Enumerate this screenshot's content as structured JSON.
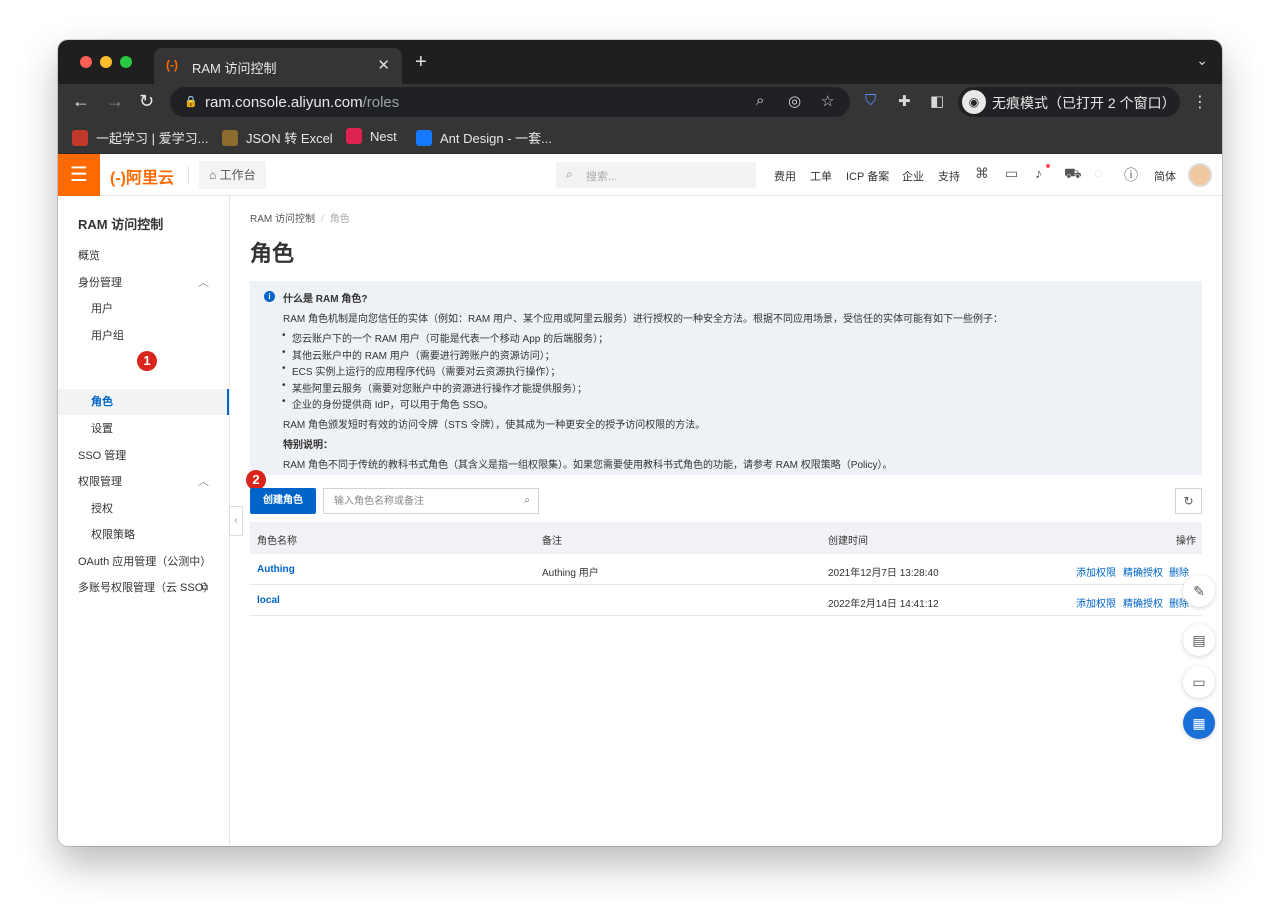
{
  "browser": {
    "tab_title": "RAM 访问控制",
    "favicon": "(-)",
    "url_host": "ram.console.aliyun.com",
    "url_path": "/roles",
    "incognito_label": "无痕模式（已打开 2 个窗口）",
    "bookmarks": [
      {
        "label": "一起学习 | 爱学习...",
        "color": "#c0392b"
      },
      {
        "label": "JSON 转 Excel",
        "color": "#8e6c2f"
      },
      {
        "label": "Nest",
        "color": "#e0234e"
      },
      {
        "label": "Ant Design - 一套...",
        "color": "#1677ff"
      }
    ]
  },
  "header": {
    "brand": "(-)阿里云",
    "workbench": "工作台",
    "search_placeholder": "搜索...",
    "links": [
      "费用",
      "工单",
      "ICP 备案",
      "企业",
      "支持"
    ],
    "lang": "简体",
    "accent": "#ff6a00"
  },
  "sidebar": {
    "title": "RAM 访问控制",
    "items": [
      {
        "label": "概览"
      },
      {
        "label": "身份管理"
      },
      {
        "label": "用户"
      },
      {
        "label": "用户组"
      },
      {
        "label": "角色"
      },
      {
        "label": "设置"
      },
      {
        "label": "SSO 管理"
      },
      {
        "label": "权限管理"
      },
      {
        "label": "授权"
      },
      {
        "label": "权限策略"
      },
      {
        "label": "OAuth 应用管理（公测中）"
      },
      {
        "label": "多账号权限管理（云 SSO）"
      }
    ],
    "badge1": "1",
    "badge2": "2"
  },
  "main": {
    "breadcrumb": [
      "RAM 访问控制",
      "角色"
    ],
    "title": "角色",
    "info": {
      "title": "什么是 RAM 角色?",
      "intro": "RAM 角色机制是向您信任的实体（例如：RAM 用户、某个应用或阿里云服务）进行授权的一种安全方法。根据不同应用场景，受信任的实体可能有如下一些例子：",
      "bullets": [
        "您云账户下的一个 RAM 用户（可能是代表一个移动 App 的后端服务）；",
        "其他云账户中的 RAM 用户（需要进行跨账户的资源访问）；",
        "ECS 实例上运行的应用程序代码（需要对云资源执行操作）；",
        "某些阿里云服务（需要对您账户中的资源进行操作才能提供服务）；",
        "企业的身份提供商 IdP，可以用于角色 SSO。"
      ],
      "sts": "RAM 角色颁发短时有效的访问令牌（STS 令牌），使其成为一种更安全的授予访问权限的方法。",
      "note_title": "特别说明：",
      "note": "RAM 角色不同于传统的教科书式角色（其含义是指一组权限集）。如果您需要使用教科书式角色的功能，请参考 RAM 权限策略（Policy）。"
    },
    "create_button": "创建角色",
    "filter_placeholder": "输入角色名称或备注",
    "table": {
      "headers": [
        "角色名称",
        "备注",
        "创建时间",
        "操作"
      ],
      "rows": [
        {
          "name": "Authing",
          "note": "Authing 用户",
          "created": "2021年12月7日 13:28:40",
          "actions": [
            "添加权限",
            "精确授权",
            "删除"
          ]
        },
        {
          "name": "local",
          "note": "",
          "created": "2022年2月14日 14:41:12",
          "actions": [
            "添加权限",
            "精确授权",
            "删除"
          ]
        }
      ]
    }
  }
}
